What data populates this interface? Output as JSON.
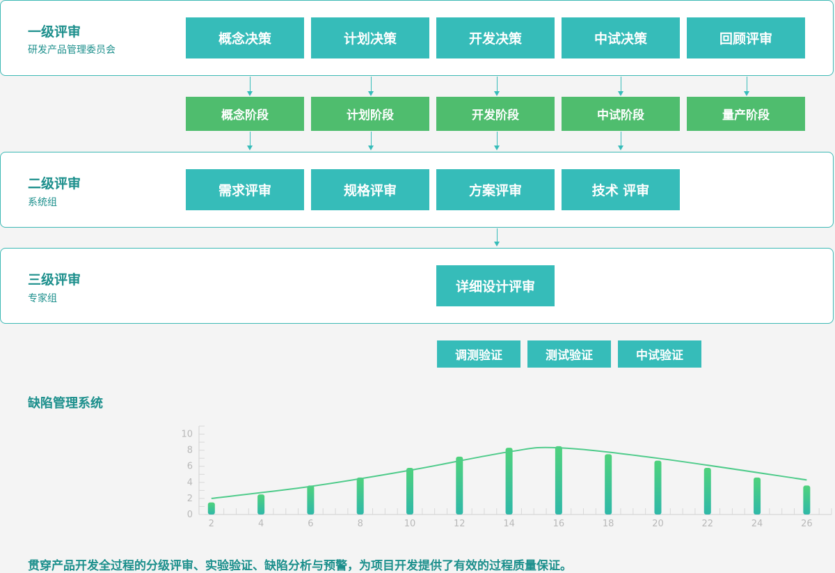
{
  "level1": {
    "title": "一级评审",
    "subtitle": "研发产品管理委员会",
    "decisions": [
      "概念决策",
      "计划决策",
      "开发决策",
      "中试决策",
      "回顾评审"
    ]
  },
  "phases": [
    "概念阶段",
    "计划阶段",
    "开发阶段",
    "中试阶段",
    "量产阶段"
  ],
  "level2": {
    "title": "二级评审",
    "subtitle": "系统组",
    "reviews": [
      "需求评审",
      "规格评审",
      "方案评审",
      "技术 评审"
    ]
  },
  "level3": {
    "title": "三级评审",
    "subtitle": "专家组",
    "review": "详细设计评审"
  },
  "verifications": [
    "调测验证",
    "测试验证",
    "中试验证"
  ],
  "defect_system": {
    "title": "缺陷管理系统"
  },
  "footer": "贯穿产品开发全过程的分级评审、实验验证、缺陷分析与预警，为项目开发提供了有效的过程质量保证。",
  "colors": {
    "teal": "#36bcb9",
    "green": "#4fbd6e",
    "text": "#1c8f8c",
    "curve": "#4ecb8a"
  },
  "chart_data": {
    "type": "bar",
    "x": [
      2,
      4,
      6,
      8,
      10,
      12,
      14,
      16,
      18,
      20,
      22,
      24,
      26
    ],
    "values": [
      1.5,
      2.5,
      3.6,
      4.6,
      5.8,
      7.2,
      8.3,
      8.5,
      7.5,
      6.7,
      5.8,
      4.6,
      3.6
    ],
    "curve": [
      [
        2,
        2.0
      ],
      [
        6,
        3.5
      ],
      [
        10,
        5.5
      ],
      [
        14,
        7.8
      ],
      [
        16,
        8.3
      ],
      [
        20,
        7.0
      ],
      [
        26,
        4.3
      ]
    ],
    "xticks": [
      2,
      4,
      6,
      8,
      10,
      12,
      14,
      16,
      18,
      20,
      22,
      24,
      26
    ],
    "yticks": [
      0,
      2,
      4,
      6,
      8,
      10
    ],
    "xlim": [
      1.5,
      27
    ],
    "ylim": [
      0,
      11
    ],
    "title": "",
    "xlabel": "",
    "ylabel": ""
  }
}
